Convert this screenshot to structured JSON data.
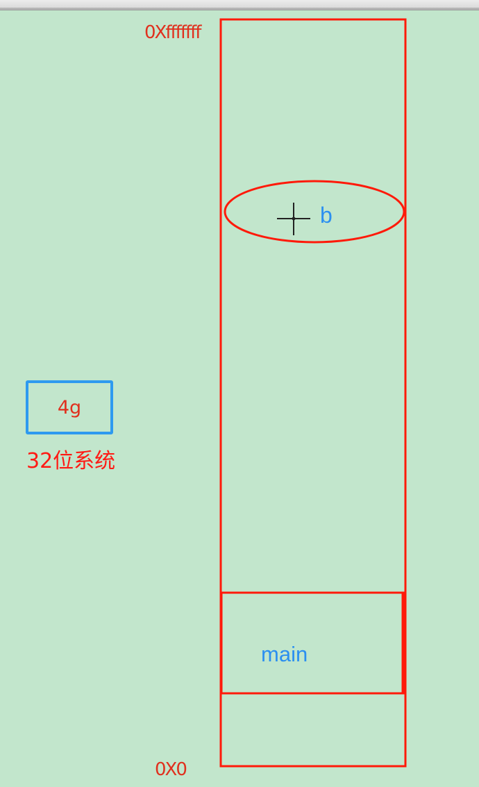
{
  "memory": {
    "high_address": "0Xfffffff",
    "low_address": "0X0",
    "variable_label": "b",
    "frame_label": "main"
  },
  "address_space": {
    "size": "4g",
    "caption": "32位系统"
  },
  "colors": {
    "background": "#c2e6cc",
    "memory_outline": "#ff1a0a",
    "address_text": "#e0301e",
    "accent_blue": "#2e9aef",
    "crosshair": "#222222"
  },
  "icons": {
    "crosshair": "crosshair-icon"
  }
}
